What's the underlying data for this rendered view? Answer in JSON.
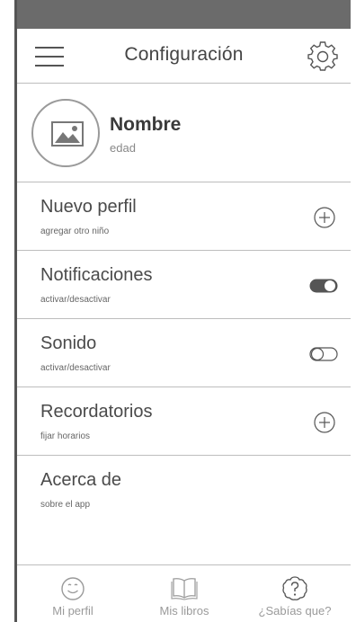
{
  "header": {
    "title": "Configuración",
    "menu_icon": "hamburger-menu-icon",
    "settings_icon": "gear-icon"
  },
  "profile": {
    "name": "Nombre",
    "age": "edad",
    "avatar_icon": "image-placeholder-icon"
  },
  "settings": {
    "items": [
      {
        "label": "Nuevo perfil",
        "sublabel": "agregar otro niño",
        "control": "add-circle-icon"
      },
      {
        "label": "Notificaciones",
        "sublabel": "activar/desactivar",
        "control": "toggle",
        "state": "on"
      },
      {
        "label": "Sonido",
        "sublabel": "activar/desactivar",
        "control": "toggle",
        "state": "off"
      },
      {
        "label": "Recordatorios",
        "sublabel": "fijar horarios",
        "control": "add-circle-icon"
      },
      {
        "label": "Acerca de",
        "sublabel": "sobre el app",
        "control": ""
      }
    ]
  },
  "tabbar": {
    "tabs": [
      {
        "label": "Mi perfil",
        "icon": "smiley-face-icon"
      },
      {
        "label": "Mis libros",
        "icon": "open-book-icon"
      },
      {
        "label": "¿Sabías que?",
        "icon": "question-bubble-icon"
      }
    ]
  },
  "colors": {
    "status_bar": "#6b6b6b",
    "text": "#4a4a4a",
    "muted": "#9a9a9a",
    "divider": "#bdbdbd"
  }
}
